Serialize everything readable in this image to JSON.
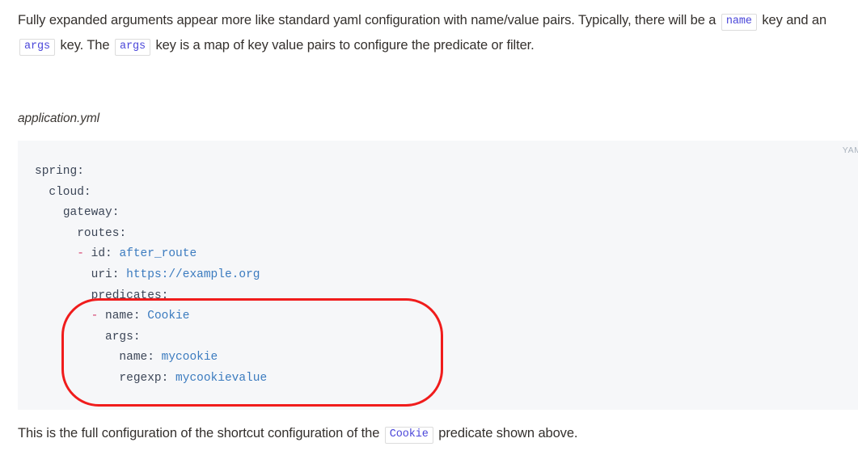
{
  "intro_paragraph": {
    "segment_1": "Fully expanded arguments appear more like standard yaml configuration with name/value pairs. Typically, there will be a ",
    "chip_1": "name",
    "segment_2": " key and an ",
    "chip_2": "args",
    "segment_3": " key. The ",
    "chip_3": "args",
    "segment_4": " key is a map of key value pairs to configure the predicate or filter."
  },
  "caption": "application.yml",
  "code_block": {
    "language_label": "YAML",
    "background_color": "#f6f7f9",
    "key_color": "#3c4657",
    "value_color": "#3b7bbf",
    "dash_color": "#d6436f",
    "lines": [
      {
        "indent": 0,
        "key": "spring",
        "value": ""
      },
      {
        "indent": 1,
        "key": "cloud",
        "value": ""
      },
      {
        "indent": 2,
        "key": "gateway",
        "value": ""
      },
      {
        "indent": 3,
        "key": "routes",
        "value": ""
      },
      {
        "indent": 4,
        "dash": true,
        "key": "id",
        "value": "after_route"
      },
      {
        "indent": 5,
        "key": "uri",
        "value": "https://example.org"
      },
      {
        "indent": 5,
        "key": "predicates",
        "value": ""
      },
      {
        "indent": 5,
        "dash": true,
        "key": "name",
        "value": "Cookie"
      },
      {
        "indent": 6,
        "key": "args",
        "value": ""
      },
      {
        "indent": 7,
        "key": "name",
        "value": "mycookie"
      },
      {
        "indent": 7,
        "key": "regexp",
        "value": "mycookievalue"
      }
    ],
    "raw_text": "spring:\n  cloud:\n    gateway:\n      routes:\n      - id: after_route\n        uri: https://example.org\n        predicates:\n        - name: Cookie\n          args:\n            name: mycookie\n            regexp: mycookievalue"
  },
  "annotation": {
    "shape": "rounded-rectangle-oval",
    "color": "#f01c1c",
    "highlights_lines": [
      "- name: Cookie",
      "args:",
      "name: mycookie",
      "regexp: mycookievalue"
    ]
  },
  "outro_paragraph": {
    "segment_1": "This is the full configuration of the shortcut configuration of the ",
    "chip_1": "Cookie",
    "segment_2": " predicate shown above."
  }
}
